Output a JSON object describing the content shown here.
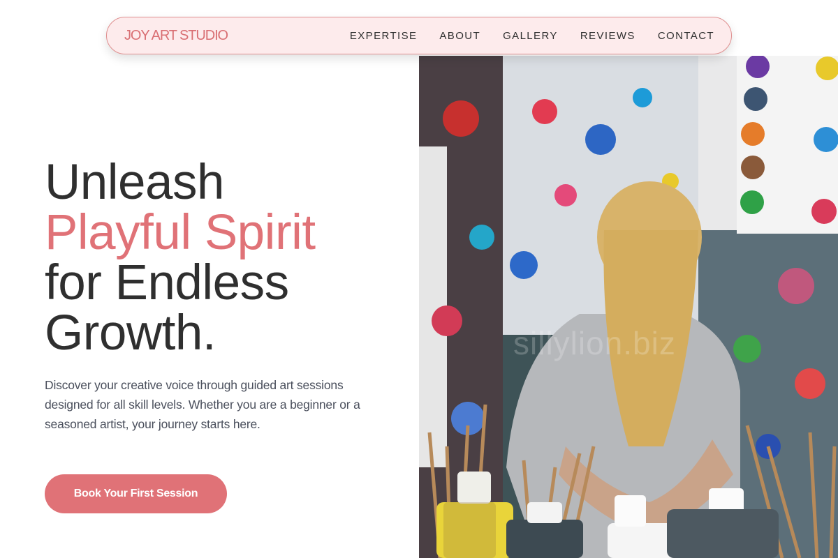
{
  "nav": {
    "logo": "JOY ART STUDIO",
    "links": [
      "EXPERTISE",
      "ABOUT",
      "GALLERY",
      "REVIEWS",
      "CONTACT"
    ]
  },
  "hero": {
    "title_line1": "Unleash",
    "title_line2": "Playful Spirit",
    "title_line3": "for Endless",
    "title_line4": "Growth.",
    "description": "Discover your creative voice through guided art sessions designed for all skill levels. Whether you are a beginner or a seasoned artist, your journey starts here.",
    "cta_label": "Book Your First Session"
  },
  "image": {
    "watermark": "sillylion.biz"
  },
  "colors": {
    "accent": "#e07277",
    "nav_bg": "#fdebec",
    "text": "#2f2f2f"
  }
}
